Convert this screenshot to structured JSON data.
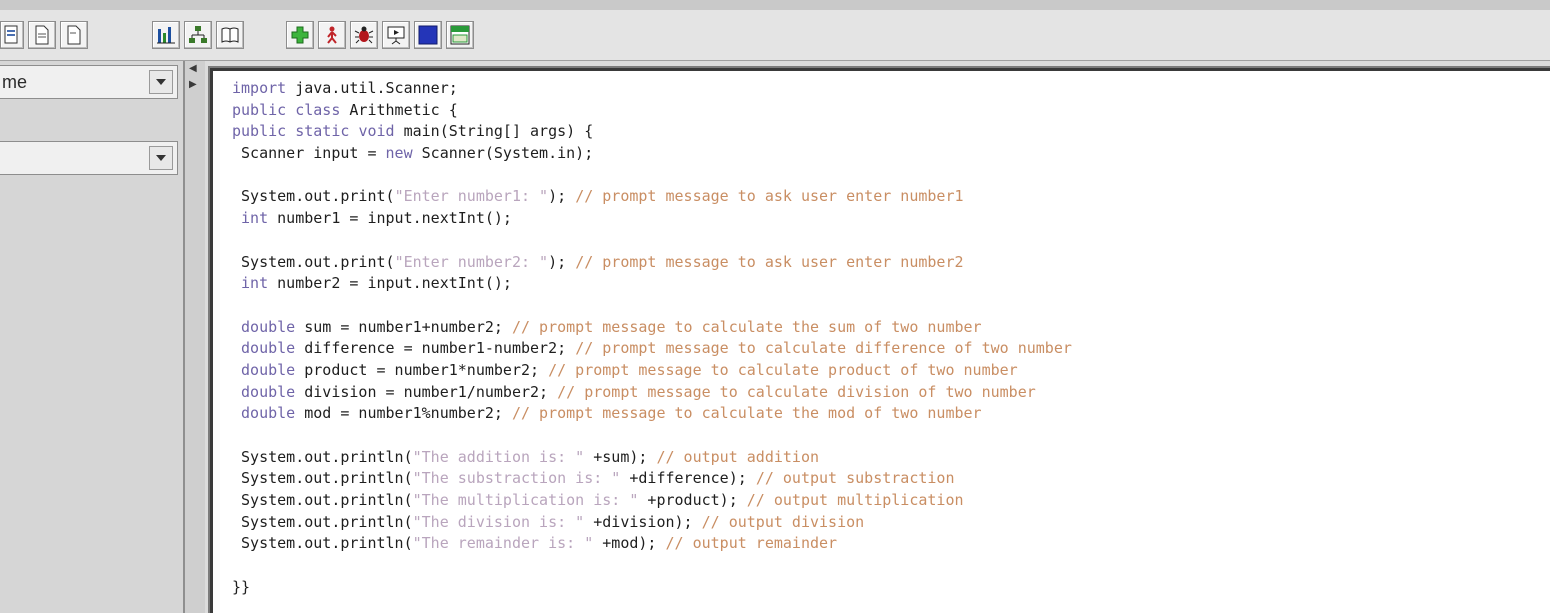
{
  "left_panel": {
    "combo1_text": "me",
    "combo2_text": ""
  },
  "toolbar": {
    "icons": [
      "file-icon",
      "document-icon",
      "page-icon",
      "chart-icon",
      "hierarchy-icon",
      "book-icon",
      "add-icon",
      "run-icon",
      "debug-icon",
      "presentation-icon",
      "stop-icon",
      "window-icon"
    ]
  },
  "code_lines": [
    [
      {
        "t": "import",
        "c": "kw"
      },
      {
        "t": " java.util.Scanner;"
      }
    ],
    [
      {
        "t": "public",
        "c": "kw"
      },
      {
        "t": " "
      },
      {
        "t": "class",
        "c": "kw"
      },
      {
        "t": " Arithmetic {"
      }
    ],
    [
      {
        "t": "public",
        "c": "kw"
      },
      {
        "t": " "
      },
      {
        "t": "static",
        "c": "kw"
      },
      {
        "t": " "
      },
      {
        "t": "void",
        "c": "kw"
      },
      {
        "t": " main(String[] args) {"
      }
    ],
    [
      {
        "t": " Scanner input = "
      },
      {
        "t": "new",
        "c": "kw"
      },
      {
        "t": " Scanner(System.in);"
      }
    ],
    [],
    [
      {
        "t": " System.out.print("
      },
      {
        "t": "\"Enter number1: \"",
        "c": "str"
      },
      {
        "t": "); "
      },
      {
        "t": "// prompt message to ask user enter number1",
        "c": "cmt"
      }
    ],
    [
      {
        "t": " "
      },
      {
        "t": "int",
        "c": "kw"
      },
      {
        "t": " number1 = input.nextInt();"
      }
    ],
    [],
    [
      {
        "t": " System.out.print("
      },
      {
        "t": "\"Enter number2: \"",
        "c": "str"
      },
      {
        "t": "); "
      },
      {
        "t": "// prompt message to ask user enter number2",
        "c": "cmt"
      }
    ],
    [
      {
        "t": " "
      },
      {
        "t": "int",
        "c": "kw"
      },
      {
        "t": " number2 = input.nextInt();"
      }
    ],
    [],
    [
      {
        "t": " "
      },
      {
        "t": "double",
        "c": "kw"
      },
      {
        "t": " sum = number1+number2; "
      },
      {
        "t": "// prompt message to calculate the sum of two number",
        "c": "cmt"
      }
    ],
    [
      {
        "t": " "
      },
      {
        "t": "double",
        "c": "kw"
      },
      {
        "t": " difference = number1-number2; "
      },
      {
        "t": "// prompt message to calculate difference of two number",
        "c": "cmt"
      }
    ],
    [
      {
        "t": " "
      },
      {
        "t": "double",
        "c": "kw"
      },
      {
        "t": " product = number1*number2; "
      },
      {
        "t": "// prompt message to calculate product of two number",
        "c": "cmt"
      }
    ],
    [
      {
        "t": " "
      },
      {
        "t": "double",
        "c": "kw"
      },
      {
        "t": " division = number1/number2; "
      },
      {
        "t": "// prompt message to calculate division of two number",
        "c": "cmt"
      }
    ],
    [
      {
        "t": " "
      },
      {
        "t": "double",
        "c": "kw"
      },
      {
        "t": " mod = number1%number2; "
      },
      {
        "t": "// prompt message to calculate the mod of two number",
        "c": "cmt"
      }
    ],
    [],
    [
      {
        "t": " System.out.println("
      },
      {
        "t": "\"The addition is: \"",
        "c": "str"
      },
      {
        "t": " +sum); "
      },
      {
        "t": "// output addition",
        "c": "cmt"
      }
    ],
    [
      {
        "t": " System.out.println("
      },
      {
        "t": "\"The substraction is: \"",
        "c": "str"
      },
      {
        "t": " +difference); "
      },
      {
        "t": "// output substraction",
        "c": "cmt"
      }
    ],
    [
      {
        "t": " System.out.println("
      },
      {
        "t": "\"The multiplication is: \"",
        "c": "str"
      },
      {
        "t": " +product); "
      },
      {
        "t": "// output multiplication",
        "c": "cmt"
      }
    ],
    [
      {
        "t": " System.out.println("
      },
      {
        "t": "\"The division is: \"",
        "c": "str"
      },
      {
        "t": " +division); "
      },
      {
        "t": "// output division",
        "c": "cmt"
      }
    ],
    [
      {
        "t": " System.out.println("
      },
      {
        "t": "\"The remainder is: \"",
        "c": "str"
      },
      {
        "t": " +mod); "
      },
      {
        "t": "// output remainder",
        "c": "cmt"
      }
    ],
    [],
    [
      {
        "t": "}}"
      }
    ]
  ],
  "colors": {
    "keyword": "#6f64a8",
    "string": "#b9a5bd",
    "comment": "#c98e63",
    "text": "#1e1e1e"
  }
}
